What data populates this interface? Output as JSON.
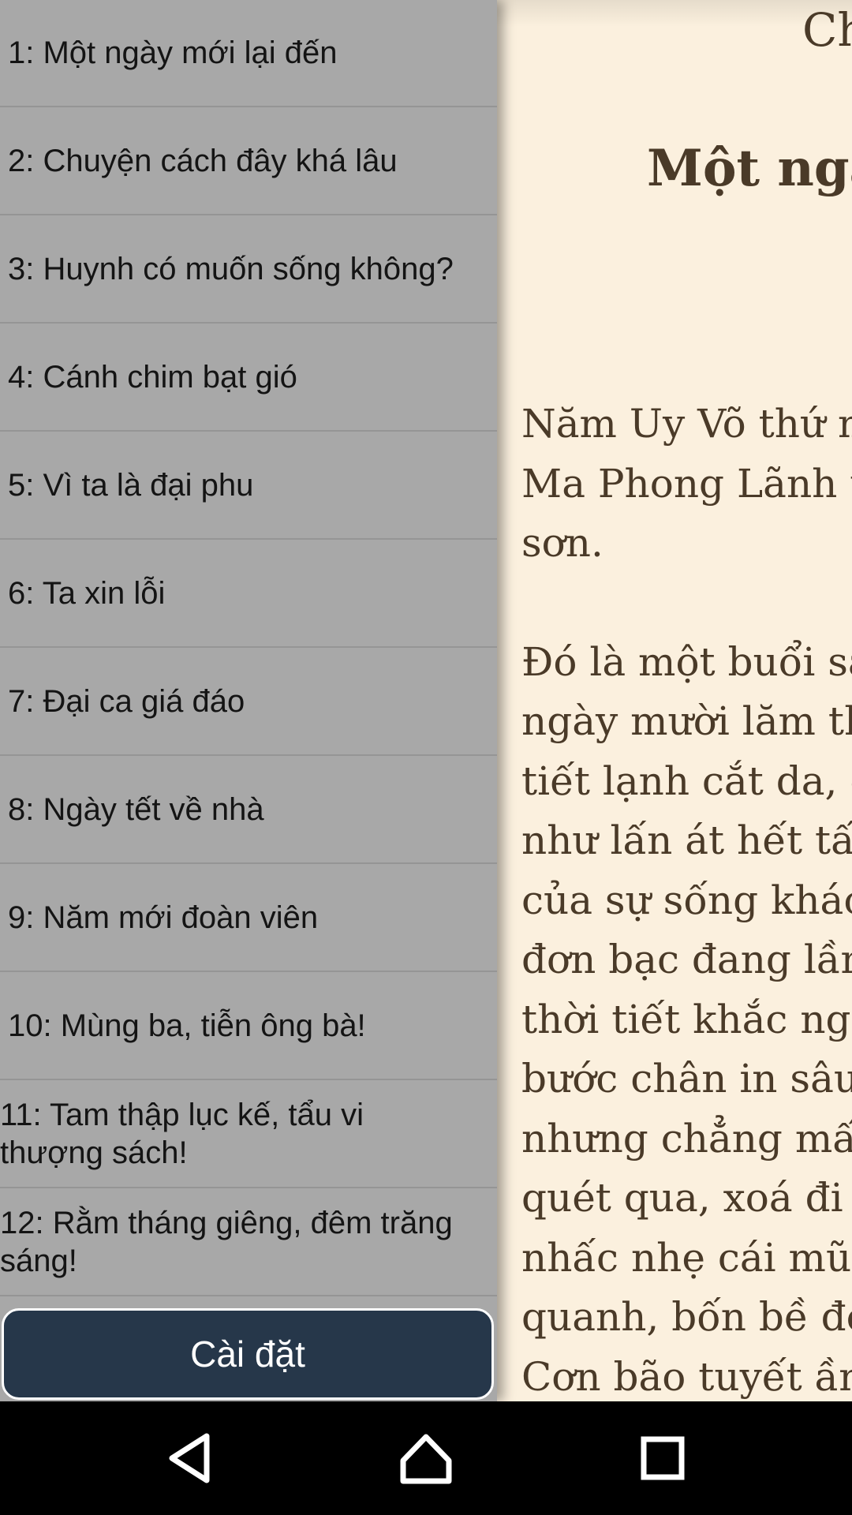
{
  "reader": {
    "chapter_label": "Ch",
    "chapter_title": "Một ngà",
    "paragraphs": [
      "Năm Uy Võ thứ m\nMa Phong Lãnh t\nsơn.",
      "Đó là một buổi sá\nngày mười lăm th\ntiết lạnh cắt da, g\nnhư lấn át hết tất\ncủa sự sống khác\nđơn bạc đang lầm\nthời tiết khắc ngh\nbước chân in sâu\nnhưng chẳng mấ\nquét qua, xoá đi n\nnhấc nhẹ cái mũ\nquanh, bốn bề đề\nCơn bão tuyết ầm"
    ]
  },
  "drawer": {
    "chapters": [
      {
        "label": "1: Một ngày mới lại đến"
      },
      {
        "label": "2: Chuyện cách đây khá lâu"
      },
      {
        "label": "3: Huynh có muốn sống không?"
      },
      {
        "label": "4: Cánh chim bạt gió"
      },
      {
        "label": "5: Vì ta là đại phu"
      },
      {
        "label": "6: Ta xin lỗi"
      },
      {
        "label": "7: Đại ca giá đáo"
      },
      {
        "label": "8: Ngày tết về nhà"
      },
      {
        "label": "9: Năm mới đoàn viên"
      },
      {
        "label": "10:  Mùng ba, tiễn ông bà!"
      },
      {
        "label": " 11: Tam thập lục kế, tẩu vi\nthượng sách!"
      },
      {
        "label": " 12: Rằm tháng giêng, đêm trăng\nsáng!"
      }
    ],
    "settings_label": "Cài đặt"
  },
  "navbar": {
    "back_icon": "back-triangle-icon",
    "home_icon": "home-icon",
    "recents_icon": "recents-square-icon"
  },
  "colors": {
    "drawer_bg": "#a8a8a8",
    "reader_bg": "#fbf0de",
    "settings_bg": "#26374a",
    "text_brown": "#4a3a28"
  }
}
